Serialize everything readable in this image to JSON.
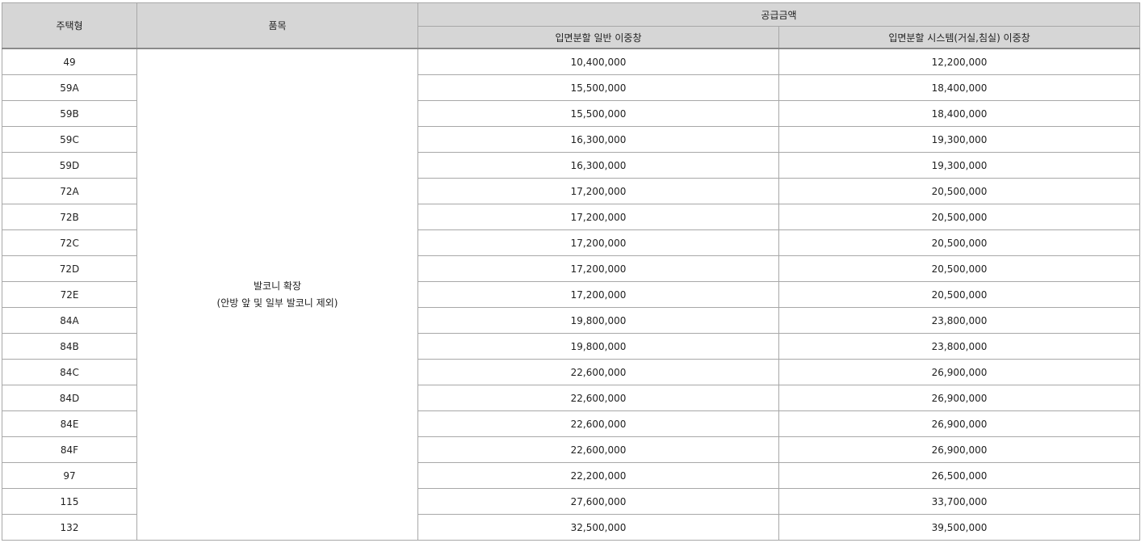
{
  "table": {
    "headers": {
      "type": "주택형",
      "item": "품목",
      "supply_price": "공급금액",
      "option_general": "입면분할 일반 이중창",
      "option_system": "입면분할 시스템(거실,침실) 이중창"
    },
    "item_text": {
      "line1": "발코니 확장",
      "line2": "(안방 앞 및 일부 발코니 제외)"
    },
    "rows": [
      {
        "type": "49",
        "general": "10,400,000",
        "system": "12,200,000"
      },
      {
        "type": "59A",
        "general": "15,500,000",
        "system": "18,400,000"
      },
      {
        "type": "59B",
        "general": "15,500,000",
        "system": "18,400,000"
      },
      {
        "type": "59C",
        "general": "16,300,000",
        "system": "19,300,000"
      },
      {
        "type": "59D",
        "general": "16,300,000",
        "system": "19,300,000"
      },
      {
        "type": "72A",
        "general": "17,200,000",
        "system": "20,500,000"
      },
      {
        "type": "72B",
        "general": "17,200,000",
        "system": "20,500,000"
      },
      {
        "type": "72C",
        "general": "17,200,000",
        "system": "20,500,000"
      },
      {
        "type": "72D",
        "general": "17,200,000",
        "system": "20,500,000"
      },
      {
        "type": "72E",
        "general": "17,200,000",
        "system": "20,500,000"
      },
      {
        "type": "84A",
        "general": "19,800,000",
        "system": "23,800,000"
      },
      {
        "type": "84B",
        "general": "19,800,000",
        "system": "23,800,000"
      },
      {
        "type": "84C",
        "general": "22,600,000",
        "system": "26,900,000"
      },
      {
        "type": "84D",
        "general": "22,600,000",
        "system": "26,900,000"
      },
      {
        "type": "84E",
        "general": "22,600,000",
        "system": "26,900,000"
      },
      {
        "type": "84F",
        "general": "22,600,000",
        "system": "26,900,000"
      },
      {
        "type": "97",
        "general": "22,200,000",
        "system": "26,500,000"
      },
      {
        "type": "115",
        "general": "27,600,000",
        "system": "33,700,000"
      },
      {
        "type": "132",
        "general": "32,500,000",
        "system": "39,500,000"
      }
    ]
  }
}
